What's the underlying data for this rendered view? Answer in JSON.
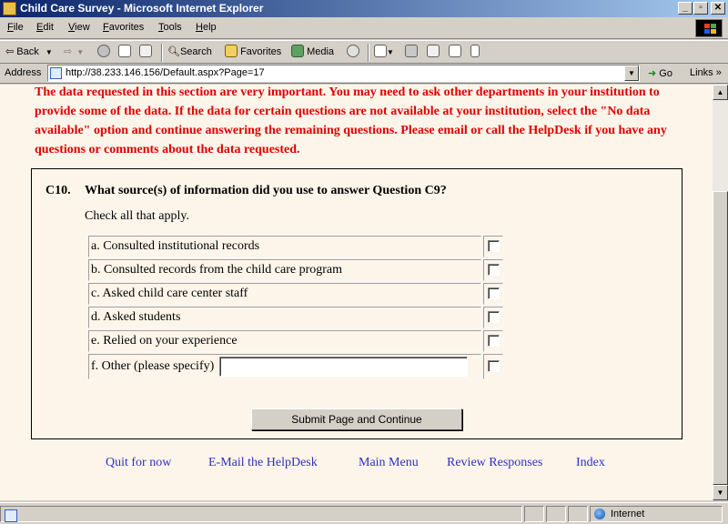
{
  "window": {
    "title": "Child Care Survey - Microsoft Internet Explorer"
  },
  "menu": [
    "File",
    "Edit",
    "View",
    "Favorites",
    "Tools",
    "Help"
  ],
  "toolbar": {
    "back": "Back",
    "search": "Search",
    "favorites": "Favorites",
    "media": "Media"
  },
  "address": {
    "label": "Address",
    "url": "http://38.233.146.156/Default.aspx?Page=17",
    "go": "Go",
    "links": "Links"
  },
  "notice": "The data requested in this section are very important. You may need to ask other departments in your institution to provide some of the data. If the data for certain questions are not available at your institution, select the \"No data available\" option and continue answering the remaining questions. Please email or call the HelpDesk if you have any questions or comments about the data requested.",
  "question": {
    "number": "C10.",
    "text": "What source(s) of information did you use to answer Question C9?",
    "instruction": "Check all that apply.",
    "options": [
      "a. Consulted institutional records",
      "b. Consulted records from the child care program",
      "c. Asked child care center staff",
      "d. Asked students",
      "e. Relied on your experience",
      "f. Other (please specify)"
    ],
    "other_value": "",
    "checked": [
      false,
      false,
      false,
      false,
      false,
      false
    ]
  },
  "submit_label": "Submit Page and Continue",
  "nav": [
    "Quit for now",
    "E-Mail the HelpDesk",
    "Main Menu",
    "Review Responses",
    "Index"
  ],
  "status": {
    "zone": "Internet"
  }
}
